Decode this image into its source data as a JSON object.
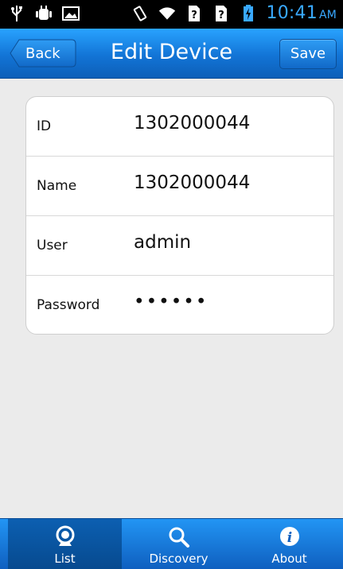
{
  "status_bar": {
    "icons": [
      "usb-icon",
      "android-debug-icon",
      "image-icon",
      "vibrate-icon",
      "wifi-icon",
      "sim-unknown-icon",
      "sim-unknown-icon",
      "battery-charging-icon"
    ],
    "time": "10:41",
    "ampm": "AM"
  },
  "header": {
    "title": "Edit Device",
    "back_label": "Back",
    "save_label": "Save"
  },
  "form": {
    "rows": [
      {
        "label": "ID",
        "value": "1302000044"
      },
      {
        "label": "Name",
        "value": "1302000044"
      },
      {
        "label": "User",
        "value": "admin"
      },
      {
        "label": "Password",
        "value": "••••••"
      }
    ]
  },
  "tabs": [
    {
      "label": "List",
      "icon": "webcam-icon",
      "active": true
    },
    {
      "label": "Discovery",
      "icon": "search-icon",
      "active": false
    },
    {
      "label": "About",
      "icon": "info-icon",
      "active": false
    }
  ],
  "colors": {
    "accent": "#1274d6",
    "time": "#39a9ff",
    "background": "#ebebeb"
  }
}
